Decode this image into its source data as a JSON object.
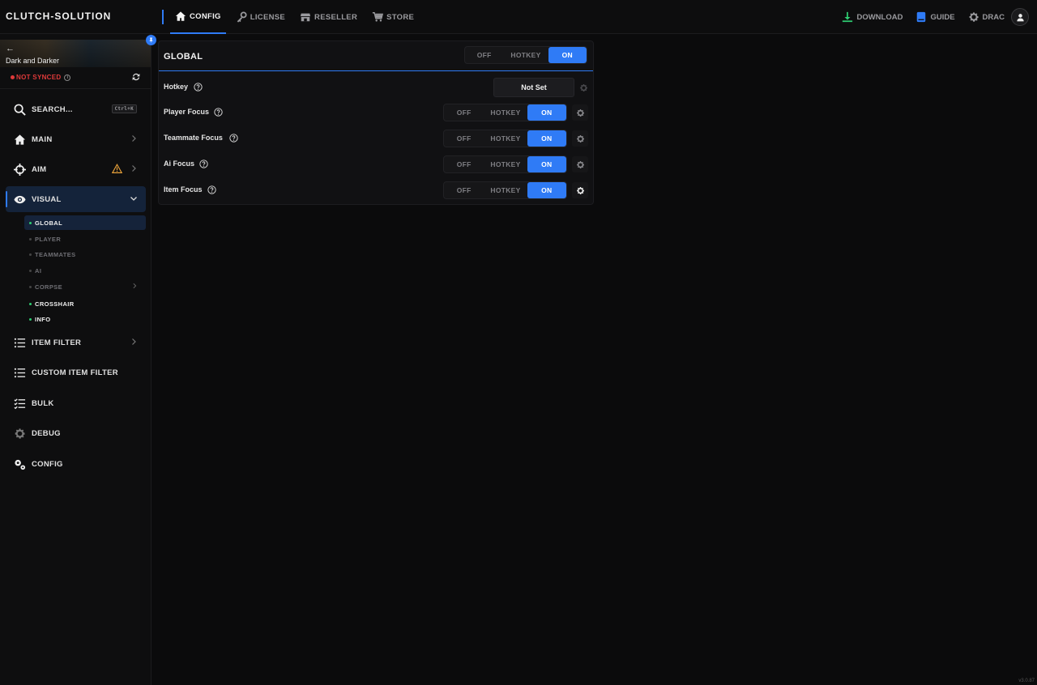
{
  "app": {
    "brand": "CLUTCH-SOLUTION",
    "version": "v3.0.87"
  },
  "nav": [
    {
      "label": "CONFIG",
      "icon": "home-icon",
      "active": true
    },
    {
      "label": "LICENSE",
      "icon": "key-icon"
    },
    {
      "label": "RESELLER",
      "icon": "store-icon"
    },
    {
      "label": "STORE",
      "icon": "cart-icon"
    }
  ],
  "top_right": {
    "download": "DOWNLOAD",
    "guide": "GUIDE",
    "user": "DRAC"
  },
  "colors": {
    "accent": "#2f7bf6",
    "error": "#e03a3a",
    "success": "#2ecc71",
    "download": "#2ecc71",
    "warning": "#e8a13a"
  },
  "sidebar": {
    "game_title": "Dark and Darker",
    "back_glyph": "←",
    "sync_status": "NOT SYNCED",
    "search": {
      "label": "SEARCH...",
      "shortcut": "Ctrl+K"
    },
    "items": [
      {
        "label": "MAIN",
        "icon": "home-icon"
      },
      {
        "label": "AIM",
        "icon": "crosshair-icon",
        "warning": true
      },
      {
        "label": "VISUAL",
        "icon": "eye-icon",
        "active": true,
        "expanded": true
      },
      {
        "label": "ITEM FILTER",
        "icon": "list-icon"
      },
      {
        "label": "CUSTOM ITEM FILTER",
        "icon": "list-icon"
      },
      {
        "label": "BULK",
        "icon": "checklist-icon"
      },
      {
        "label": "DEBUG",
        "icon": "gear-icon"
      },
      {
        "label": "CONFIG",
        "icon": "gears-icon"
      }
    ],
    "visual_sub": [
      {
        "label": "GLOBAL",
        "state": "active"
      },
      {
        "label": "PLAYER",
        "state": "off"
      },
      {
        "label": "TEAMMATES",
        "state": "off"
      },
      {
        "label": "AI",
        "state": "off"
      },
      {
        "label": "CORPSE",
        "state": "off"
      },
      {
        "label": "CROSSHAIR",
        "state": "on"
      },
      {
        "label": "INFO",
        "state": "on"
      }
    ]
  },
  "panel": {
    "title": "GLOBAL",
    "toggle": {
      "off": "OFF",
      "hotkey": "HOTKEY",
      "on": "ON",
      "selected": "ON"
    },
    "rows": [
      {
        "label": "Hotkey",
        "type": "hotkey",
        "value": "Not Set"
      },
      {
        "label": "Player Focus",
        "type": "toggle",
        "off": "OFF",
        "hotkey": "HOTKEY",
        "on": "ON",
        "selected": "ON"
      },
      {
        "label": "Teammate Focus",
        "type": "toggle",
        "off": "OFF",
        "hotkey": "HOTKEY",
        "on": "ON",
        "selected": "ON"
      },
      {
        "label": "Ai Focus",
        "type": "toggle",
        "off": "OFF",
        "hotkey": "HOTKEY",
        "on": "ON",
        "selected": "ON"
      },
      {
        "label": "Item Focus",
        "type": "toggle",
        "off": "OFF",
        "hotkey": "HOTKEY",
        "on": "ON",
        "selected": "ON"
      }
    ]
  }
}
